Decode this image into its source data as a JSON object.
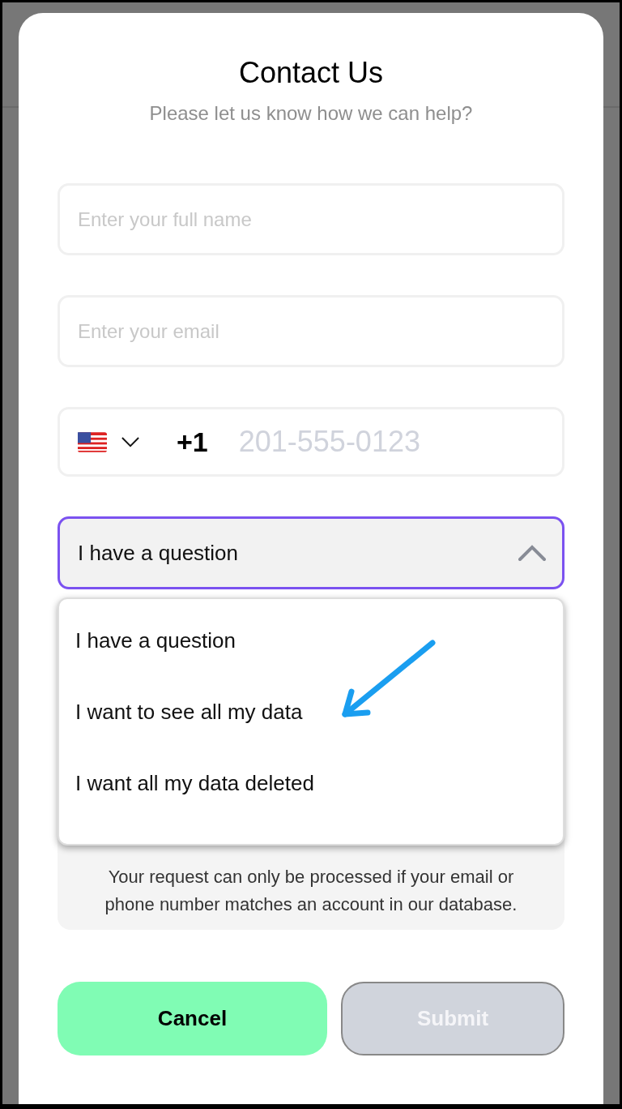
{
  "dialog": {
    "title": "Contact Us",
    "subtitle": "Please let us know how we can help?"
  },
  "fields": [
    {
      "kind": "text",
      "placeholder": "Enter your full name"
    },
    {
      "kind": "text",
      "placeholder": "Enter your email"
    },
    {
      "kind": "phone",
      "dial_code": "+1",
      "placeholder": "201-555-0123"
    }
  ],
  "select": {
    "value": "I have a question",
    "expanded": true,
    "options": [
      {
        "label": "I have a question"
      },
      {
        "label": "I want to see all my data"
      },
      {
        "label": "I want all my data deleted"
      }
    ]
  },
  "notice": "Your request can only be processed if your email or phone number matches an account in our database.",
  "buttons": [
    {
      "kind": "cancel",
      "label": "Cancel",
      "disabled": false
    },
    {
      "kind": "submit",
      "label": "Submit",
      "disabled": true
    }
  ]
}
